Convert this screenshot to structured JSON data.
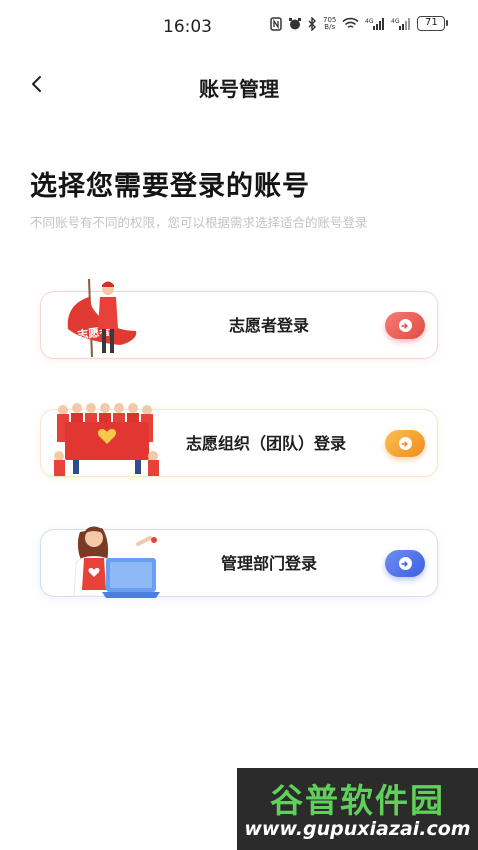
{
  "status_bar": {
    "time": "16:03",
    "net_speed_value": "705",
    "net_speed_unit": "B/s",
    "battery": "71",
    "icons": [
      "nfc-icon",
      "alarm-icon",
      "bluetooth-icon",
      "wifi-icon",
      "signal-4g-icon",
      "signal-4g-icon",
      "battery-icon"
    ]
  },
  "nav": {
    "title": "账号管理",
    "back_icon": "chevron-left-icon"
  },
  "heading": "选择您需要登录的账号",
  "subheading": "不同账号有不同的权限，您可以根据需求选择适合的账号登录",
  "options": [
    {
      "label": "志愿者登录",
      "illustration": "volunteer-flag-illustration",
      "banner_text": "志愿者",
      "accent": "#e24a44"
    },
    {
      "label": "志愿组织（团队）登录",
      "illustration": "volunteer-team-illustration",
      "accent": "#f08a1c"
    },
    {
      "label": "管理部门登录",
      "illustration": "admin-laptop-illustration",
      "accent": "#3b5fe0"
    }
  ],
  "watermark": {
    "name": "谷普软件园",
    "url": "www.gupuxiazai.com"
  }
}
